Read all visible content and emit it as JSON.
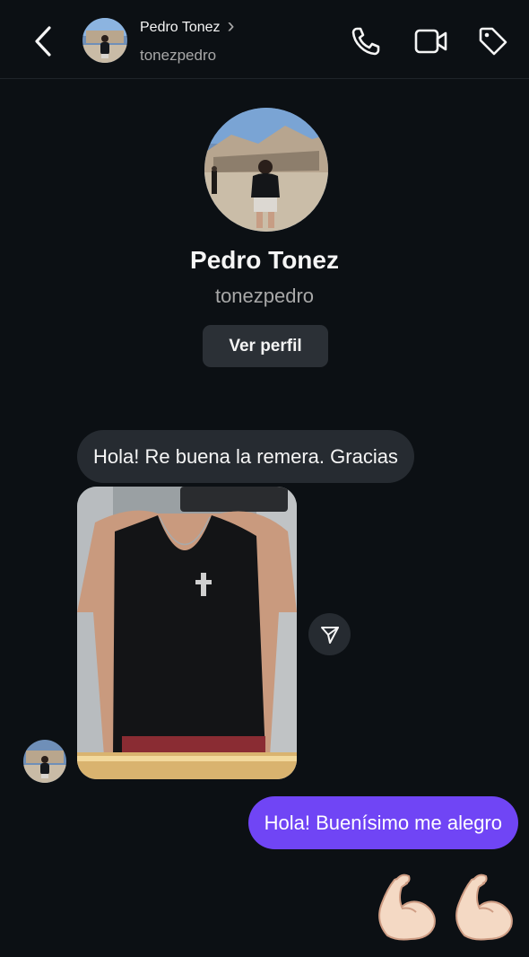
{
  "header": {
    "back_icon": "chevron-left-icon",
    "name": "Pedro Tonez",
    "name_chevron": "›",
    "username": "tonezpedro",
    "actions": [
      "phone-icon",
      "video-camera-icon",
      "tag-icon"
    ]
  },
  "profile": {
    "name": "Pedro Tonez",
    "username": "tonezpedro",
    "view_profile_label": "Ver perfil"
  },
  "messages": {
    "incoming_text": "Hola! Re buena la remera. Gracias",
    "incoming_photo": "photo-of-black-tank-top",
    "outgoing_text": "Hola! Buenísimo me alegro",
    "outgoing_emoji": "💪💪"
  },
  "colors": {
    "background": "#0c1014",
    "incoming_bubble": "#262b31",
    "outgoing_bubble": "#7045f5",
    "secondary_text": "#a8a8a8"
  }
}
